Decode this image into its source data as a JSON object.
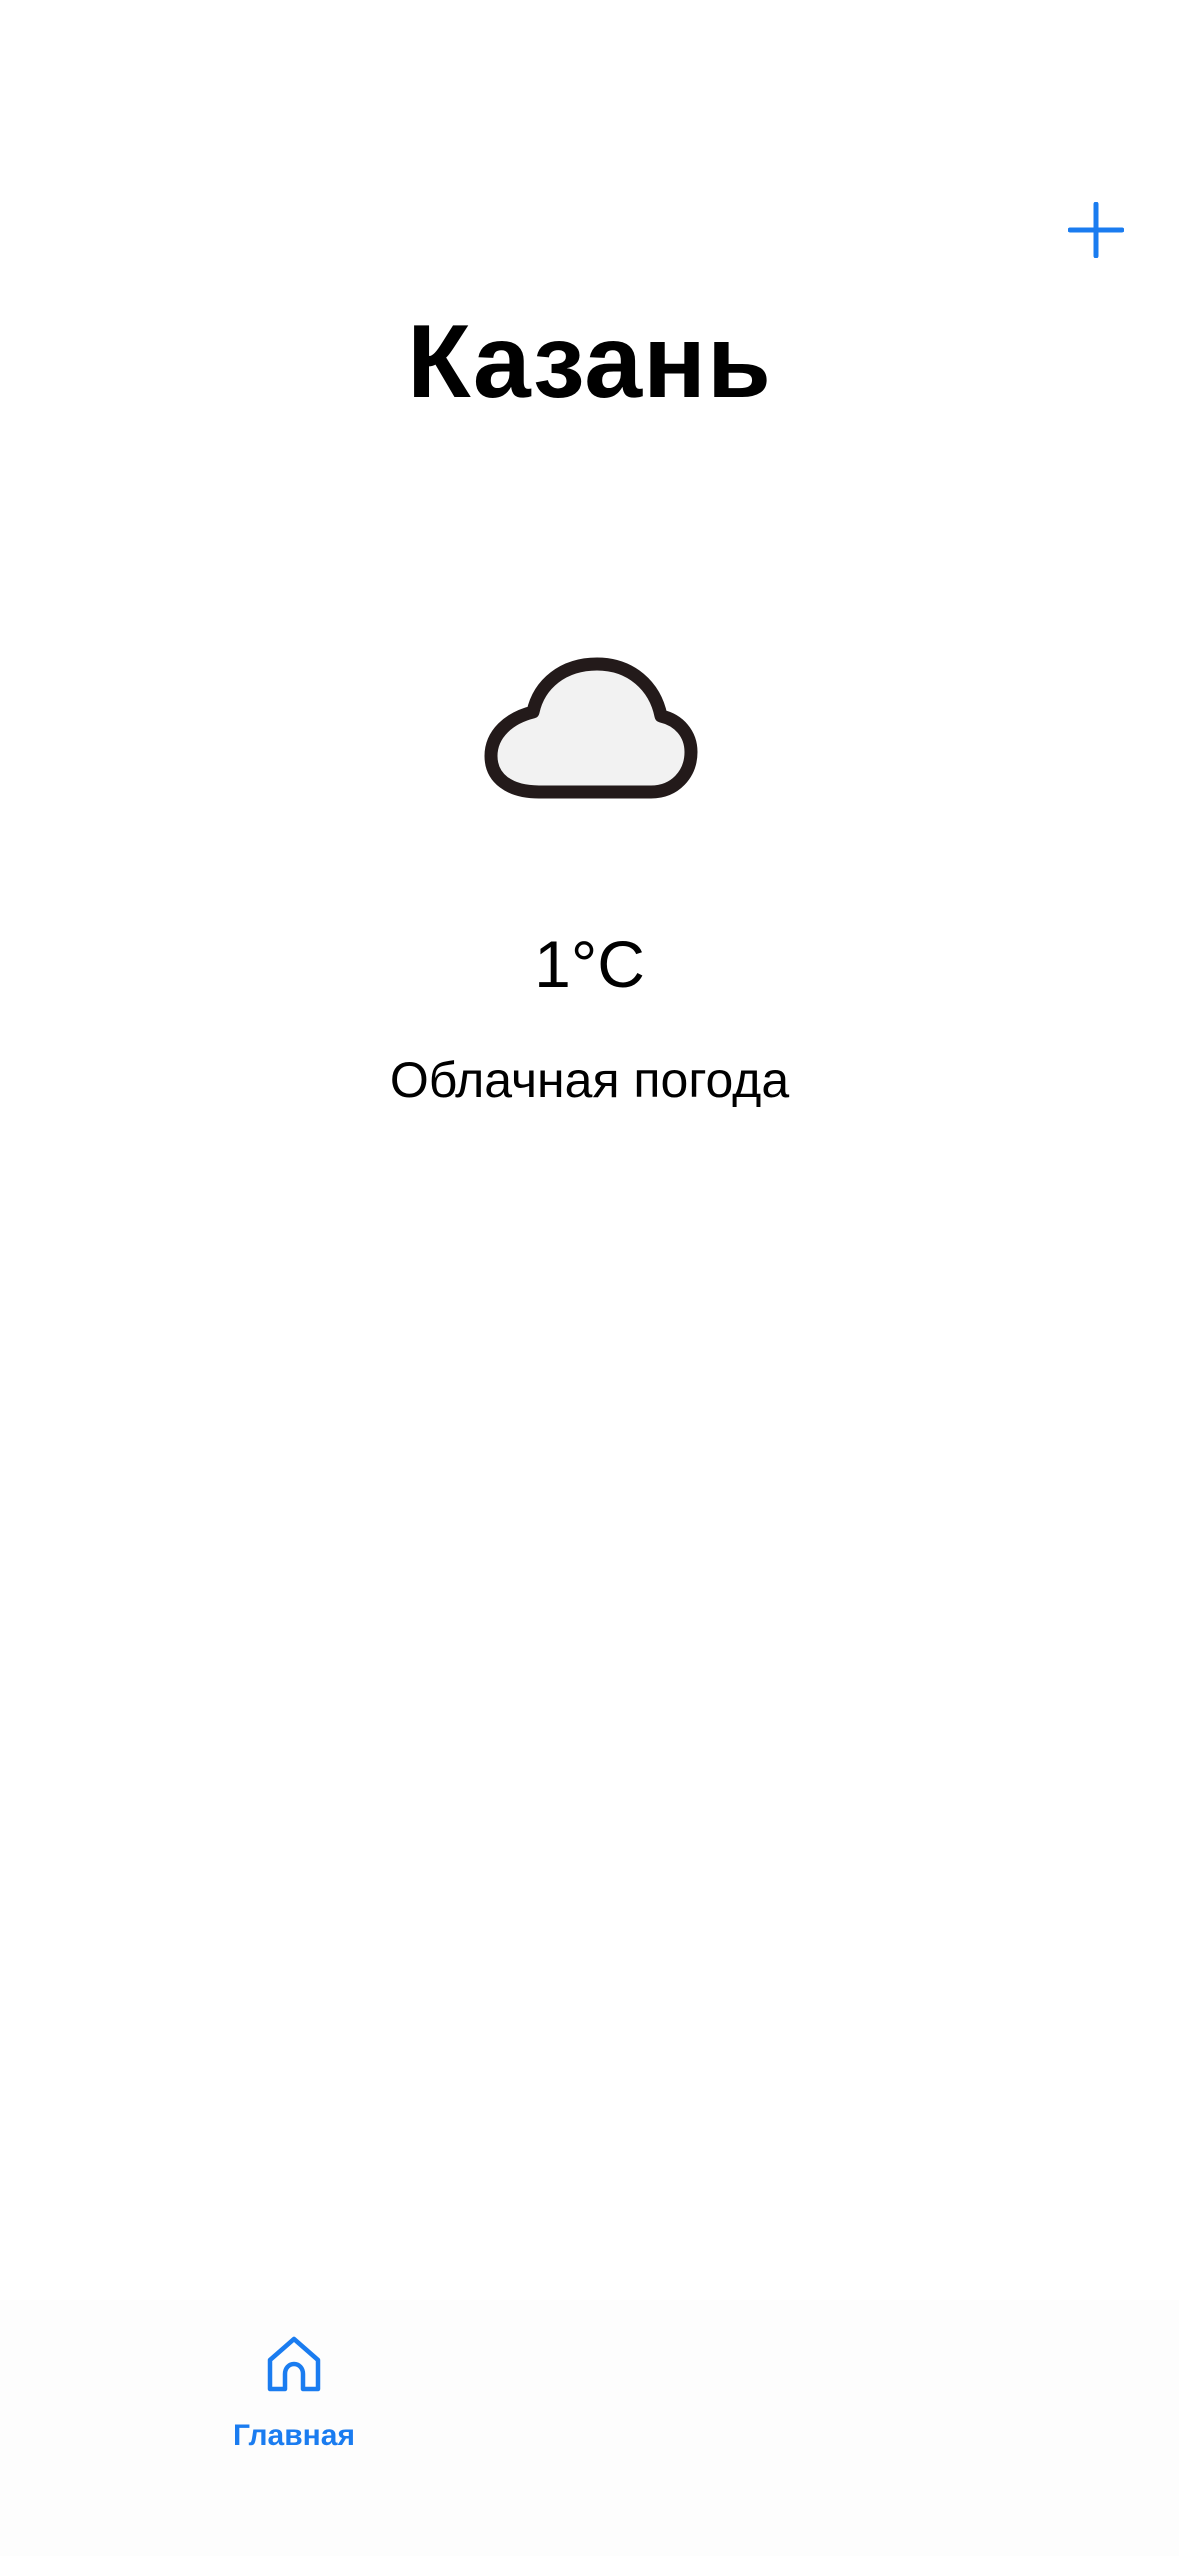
{
  "header": {
    "add_icon": "plus-icon",
    "accent_color": "#1a7cf0"
  },
  "weather": {
    "city": "Казань",
    "icon": "cloud-icon",
    "temperature": "1°C",
    "condition": "Облачная погода"
  },
  "tab_bar": {
    "items": [
      {
        "label": "Главная",
        "icon": "home-icon",
        "selected": true
      }
    ],
    "active_color": "#1a7cf0"
  }
}
